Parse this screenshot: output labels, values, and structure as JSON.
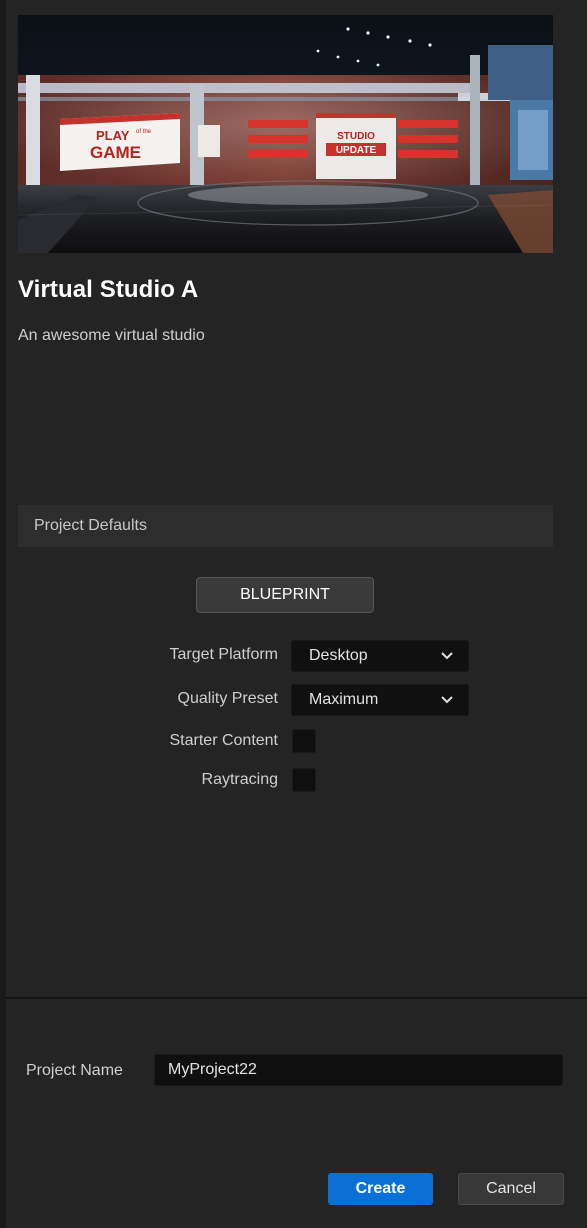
{
  "template": {
    "title": "Virtual Studio A",
    "description": "An awesome virtual studio",
    "preview": {
      "left_screen_line1": "PLAY",
      "left_screen_small": "of the",
      "left_screen_line2": "GAME",
      "center_screen_line1": "STUDIO",
      "center_screen_line2": "UPDATE"
    }
  },
  "defaults": {
    "section_title": "Project Defaults",
    "blueprint_label": "BLUEPRINT",
    "target_platform": {
      "label": "Target Platform",
      "value": "Desktop"
    },
    "quality_preset": {
      "label": "Quality Preset",
      "value": "Maximum"
    },
    "starter_content": {
      "label": "Starter Content",
      "checked": false
    },
    "raytracing": {
      "label": "Raytracing",
      "checked": false
    }
  },
  "project": {
    "name_label": "Project Name",
    "name_value": "MyProject22"
  },
  "actions": {
    "create_label": "Create",
    "cancel_label": "Cancel"
  },
  "colors": {
    "accent": "#0a70d6",
    "panel": "#242424",
    "field": "#0f0f0f"
  }
}
